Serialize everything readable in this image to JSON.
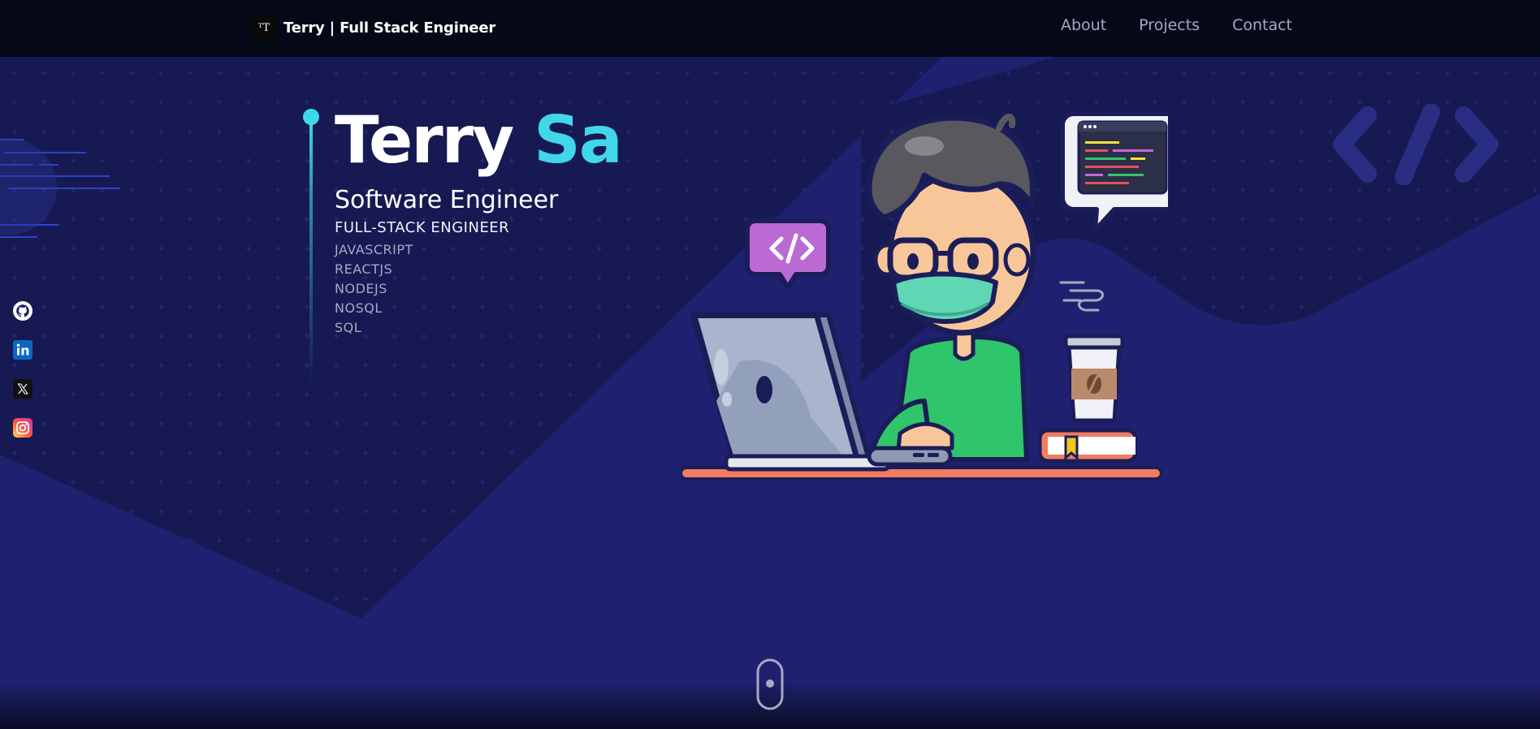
{
  "nav": {
    "logo_text": "ᵀT",
    "brand_title": "Terry | Full Stack Engineer",
    "links": [
      {
        "label": "About"
      },
      {
        "label": "Projects"
      },
      {
        "label": "Contact"
      }
    ]
  },
  "social": [
    {
      "icon": "github-icon"
    },
    {
      "icon": "linkedin-icon"
    },
    {
      "icon": "x-twitter-icon"
    },
    {
      "icon": "instagram-icon"
    }
  ],
  "hero": {
    "first_name": "Terry",
    "last_name": "Sa",
    "role": "Software Engineer",
    "subtitle": "FULL-STACK ENGINEER",
    "skills": [
      "JAVASCRIPT",
      "REACTJS",
      "NODEJS",
      "NOSQL",
      "SQL"
    ]
  },
  "colors": {
    "accent": "#40d7ea",
    "nav_bg": "#050816",
    "hero_bg": "#1d1f63",
    "muted_text": "#aaa6c3"
  }
}
